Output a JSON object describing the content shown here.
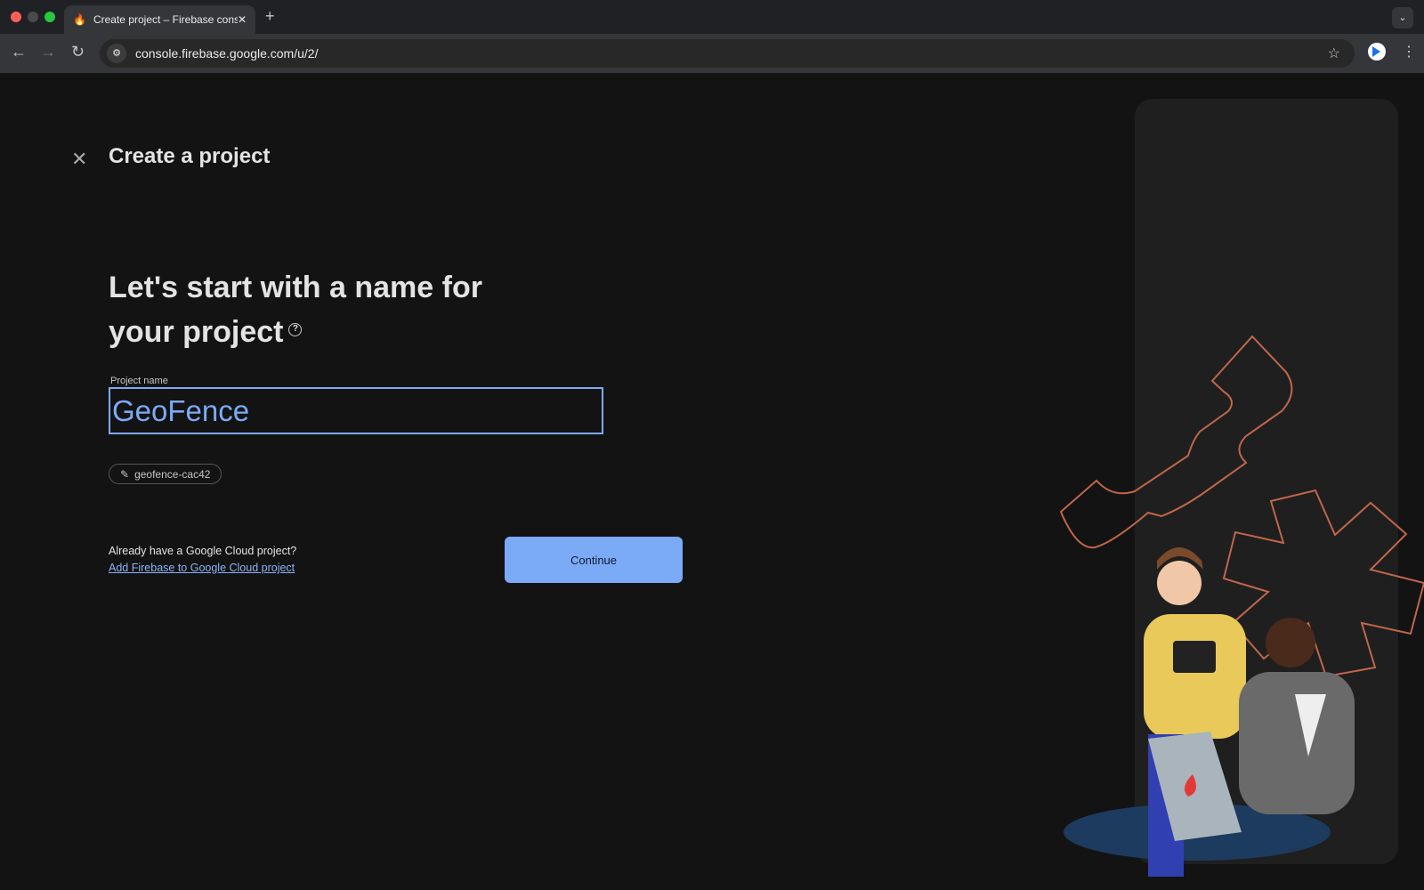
{
  "browser": {
    "tab_title": "Create project – Firebase console",
    "url": "console.firebase.google.com/u/2/"
  },
  "page": {
    "title": "Create a project",
    "heading_line1": "Let's start with a name for",
    "heading_line2": "your project",
    "project_name_label": "Project name",
    "project_name_value": "GeoFence",
    "project_id": "geofence-cac42",
    "existing_question": "Already have a Google Cloud project?",
    "existing_link": "Add Firebase to Google Cloud project",
    "continue_label": "Continue"
  },
  "colors": {
    "accent": "#7baaf7",
    "background": "#131313",
    "decor": "#c0664a"
  }
}
